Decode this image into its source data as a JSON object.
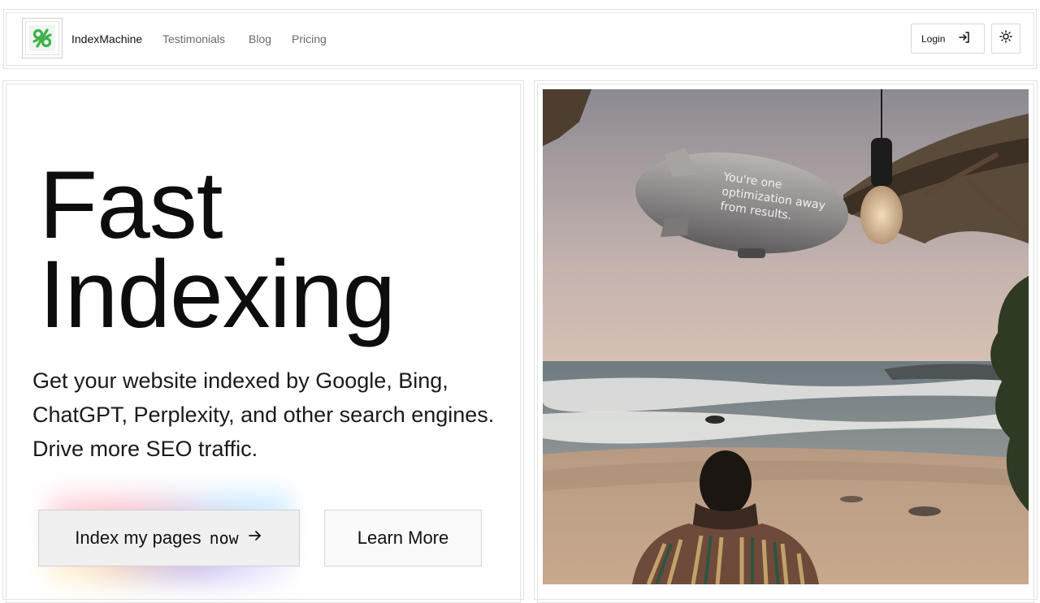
{
  "header": {
    "brand": "IndexMachine",
    "nav": [
      {
        "label": "Testimonials"
      },
      {
        "label": "Blog"
      },
      {
        "label": "Pricing"
      }
    ],
    "login_label": "Login"
  },
  "hero": {
    "title_line1": "Fast",
    "title_line2": "Indexing",
    "subtitle": "Get your website indexed by Google, Bing, ChatGPT, Perplexity, and other search engines. Drive more SEO traffic.",
    "cta_label": "Index my pages",
    "cta_mono": "now",
    "learn_more": "Learn More"
  },
  "image": {
    "blimp_text": [
      "You're one",
      "optimization away",
      "from results."
    ]
  },
  "colors": {
    "logo_green": "#3fb14a",
    "text": "#111111",
    "muted": "#6a6a6a"
  }
}
